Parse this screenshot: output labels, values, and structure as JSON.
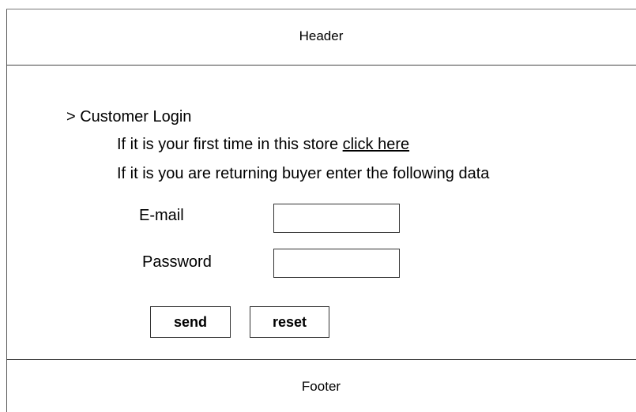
{
  "header": {
    "label": "Header"
  },
  "login": {
    "title": "> Customer Login",
    "first_time_prefix": "If it is your first time in this store ",
    "first_time_link": "click here",
    "returning_text": "If it is you are returning buyer enter the following data",
    "email": {
      "label": "E-mail",
      "value": ""
    },
    "password": {
      "label": "Password",
      "value": ""
    },
    "buttons": {
      "send": "send",
      "reset": "reset"
    }
  },
  "footer": {
    "label": "Footer"
  }
}
